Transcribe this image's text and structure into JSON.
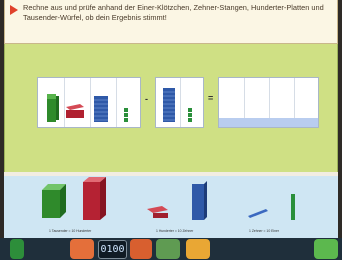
{
  "instruction": {
    "text": "Rechne aus und prüfe anhand der Einer-Klötzchen, Zehner-Stangen, Hunderter-Platten und Tausender-Würfel, ob dein Ergebnis stimmt!"
  },
  "equation": {
    "minus": "-",
    "equals": "="
  },
  "tray": {
    "items": [
      {
        "label": "1 Tausender = 10 Hunderter"
      },
      {
        "label": "1 Hunderter = 10 Zehner"
      },
      {
        "label": "1 Zehner = 10 Einer"
      }
    ]
  },
  "toolbar": {
    "counter": "0100"
  }
}
